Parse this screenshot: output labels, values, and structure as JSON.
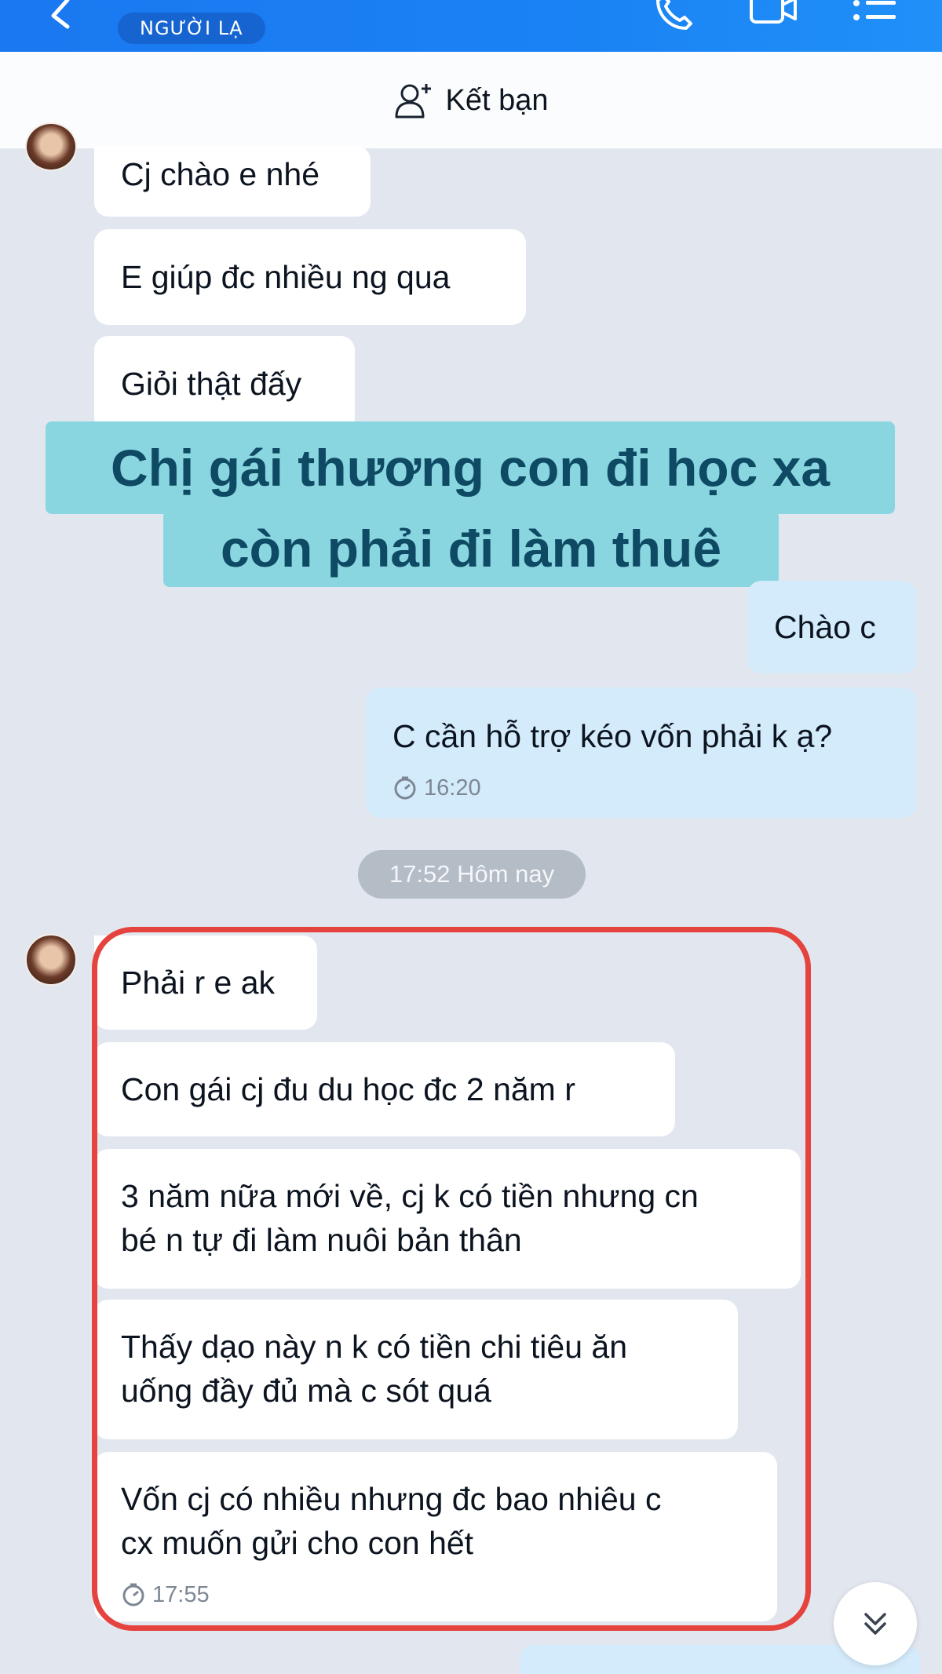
{
  "header": {
    "badge": "NGƯỜI LẠ",
    "add_friend_label": "Kết bạn"
  },
  "messages_top": [
    "Cj chào e nhé",
    "E giúp đc nhiều ng qua",
    "Giỏi thật đấy"
  ],
  "overlay_caption": {
    "line1": "Chị gái thương con đi học xa",
    "line2": "còn phải đi làm thuê"
  },
  "messages_me": [
    "Chào c",
    "C cần hỗ trợ kéo vốn phải k ạ?"
  ],
  "me_time": "16:20",
  "date_separator": "17:52 Hôm nay",
  "messages_bottom": [
    "Phải r e ak",
    "Con gái cj đu du học đc 2 năm r",
    "3 năm nữa mới về, cj k có tiền nhưng cn",
    "bé n tự đi làm nuôi bản thân",
    "Thấy dạo này n k có tiền chi tiêu ăn",
    "uống đầy đủ mà c sót quá",
    "Vốn cj có nhiều nhưng đc bao nhiêu c",
    "cx muốn gửi cho con hết"
  ],
  "bottom_time": "17:55",
  "colors": {
    "header_blue": "#1a7ef2",
    "my_bubble": "#d4ebfb",
    "highlight_frame": "#e5433d",
    "caption_bg": "#8ad6e0",
    "caption_text": "#0e4a63"
  }
}
